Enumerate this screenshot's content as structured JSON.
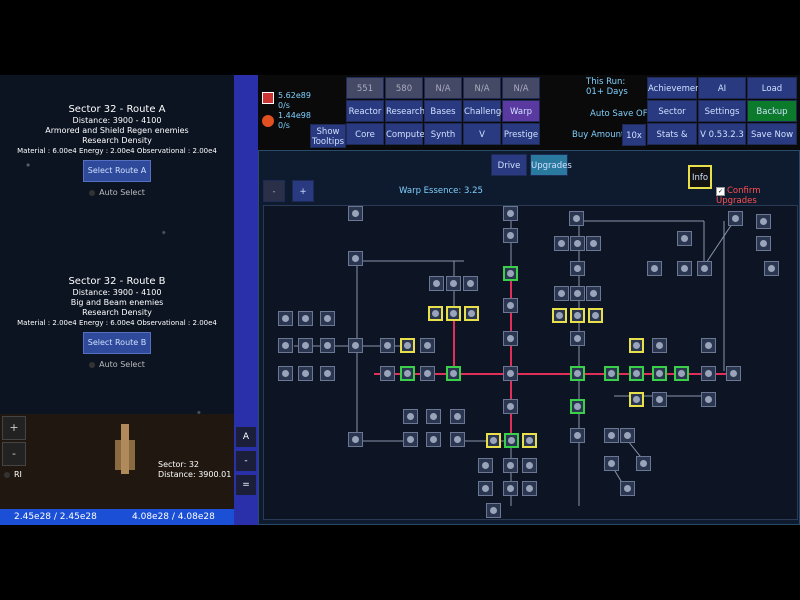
{
  "routes": [
    {
      "title": "Sector 32 - Route A",
      "distance": "Distance: 3900 - 4100",
      "enemies": "Armored and Shield Regen enemies",
      "density": "Research Density",
      "values": "Material : 6.00e4 Energy : 2.00e4 Observational : 2.00e4",
      "button": "Select Route A",
      "auto": "Auto Select"
    },
    {
      "title": "Sector 32 - Route B",
      "distance": "Distance: 3900 - 4100",
      "enemies": "Big and Beam enemies",
      "density": "Research Density",
      "values": "Material : 2.00e4 Energy : 6.00e4 Observational : 2.00e4",
      "button": "Select Route B",
      "auto": "Auto Select"
    }
  ],
  "ship": {
    "sector": "Sector: 32",
    "distance": "Distance: 3900.01",
    "ri": "RI",
    "plus": "+",
    "minus": "-"
  },
  "bottom": {
    "left": "2.45e28 / 2.45e28",
    "right": "4.08e28 / 4.08e28"
  },
  "strip": {
    "a": "A",
    "dash": "-",
    "eq": "="
  },
  "resources": {
    "r1": "5.62e89",
    "r1rate": "0/s",
    "r2": "1.44e98",
    "r2rate": "0/s"
  },
  "header": {
    "show_tooltips": "Show Tooltips",
    "row1": [
      "551",
      "580",
      "N/A",
      "N/A",
      "N/A"
    ],
    "row2": [
      "Reactor",
      "Research",
      "Bases",
      "Challenge",
      "Warp Driv"
    ],
    "row3": [
      "Core",
      "Compute",
      "Synth",
      "V Device",
      "Prestige"
    ],
    "this_run": "This Run:",
    "run_days": "01+ Days",
    "auto_save": "Auto Save OFF",
    "buy_amount": "Buy Amount:",
    "buy_value": "10x",
    "right1": [
      "Achievemen",
      "AI",
      "Load"
    ],
    "right2": [
      "Sector Data",
      "Settings",
      "Backup"
    ],
    "right3": [
      "Stats & Info",
      "V 0.53.2.3",
      "Save Now"
    ]
  },
  "main": {
    "tab_drive": "Drive",
    "tab_upgrades": "Upgrades",
    "info": "Info",
    "confirm": "Confirm Upgrades",
    "minus": "-",
    "plus": "+",
    "warp_essence": "Warp Essence: 3.25"
  },
  "colors": {
    "accent": "#2a3a80",
    "highlight": "#e8e04a",
    "bought": "#3ad04a",
    "redline": "#e0305a"
  }
}
